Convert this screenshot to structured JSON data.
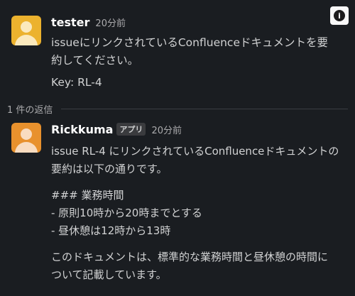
{
  "colors": {
    "background": "#1a1d21",
    "tester_avatar": "#ecb22e",
    "rickkuma_avatar": "#e8912d"
  },
  "icons": {
    "info": "info-icon"
  },
  "info_button": {
    "glyph": "i"
  },
  "messages": [
    {
      "author": "tester",
      "time": "20分前",
      "lines": [
        "issueにリンクされているConfluenceドキュメントを要",
        "約してください。",
        "Key: RL-4"
      ]
    },
    {
      "author": "Rickkuma",
      "badge": "アプリ",
      "time": "20分前",
      "lines": [
        "issue RL-4 にリンクされているConfluenceドキュメントの",
        "要約は以下の通りです。",
        "### 業務時間",
        "- 原則10時から20時までとする",
        "- 昼休憩は12時から13時",
        "このドキュメントは、標準的な業務時間と昼休憩の時間に",
        "ついて記載しています。"
      ]
    }
  ],
  "thread": {
    "reply_count_label": "1 件の返信"
  }
}
